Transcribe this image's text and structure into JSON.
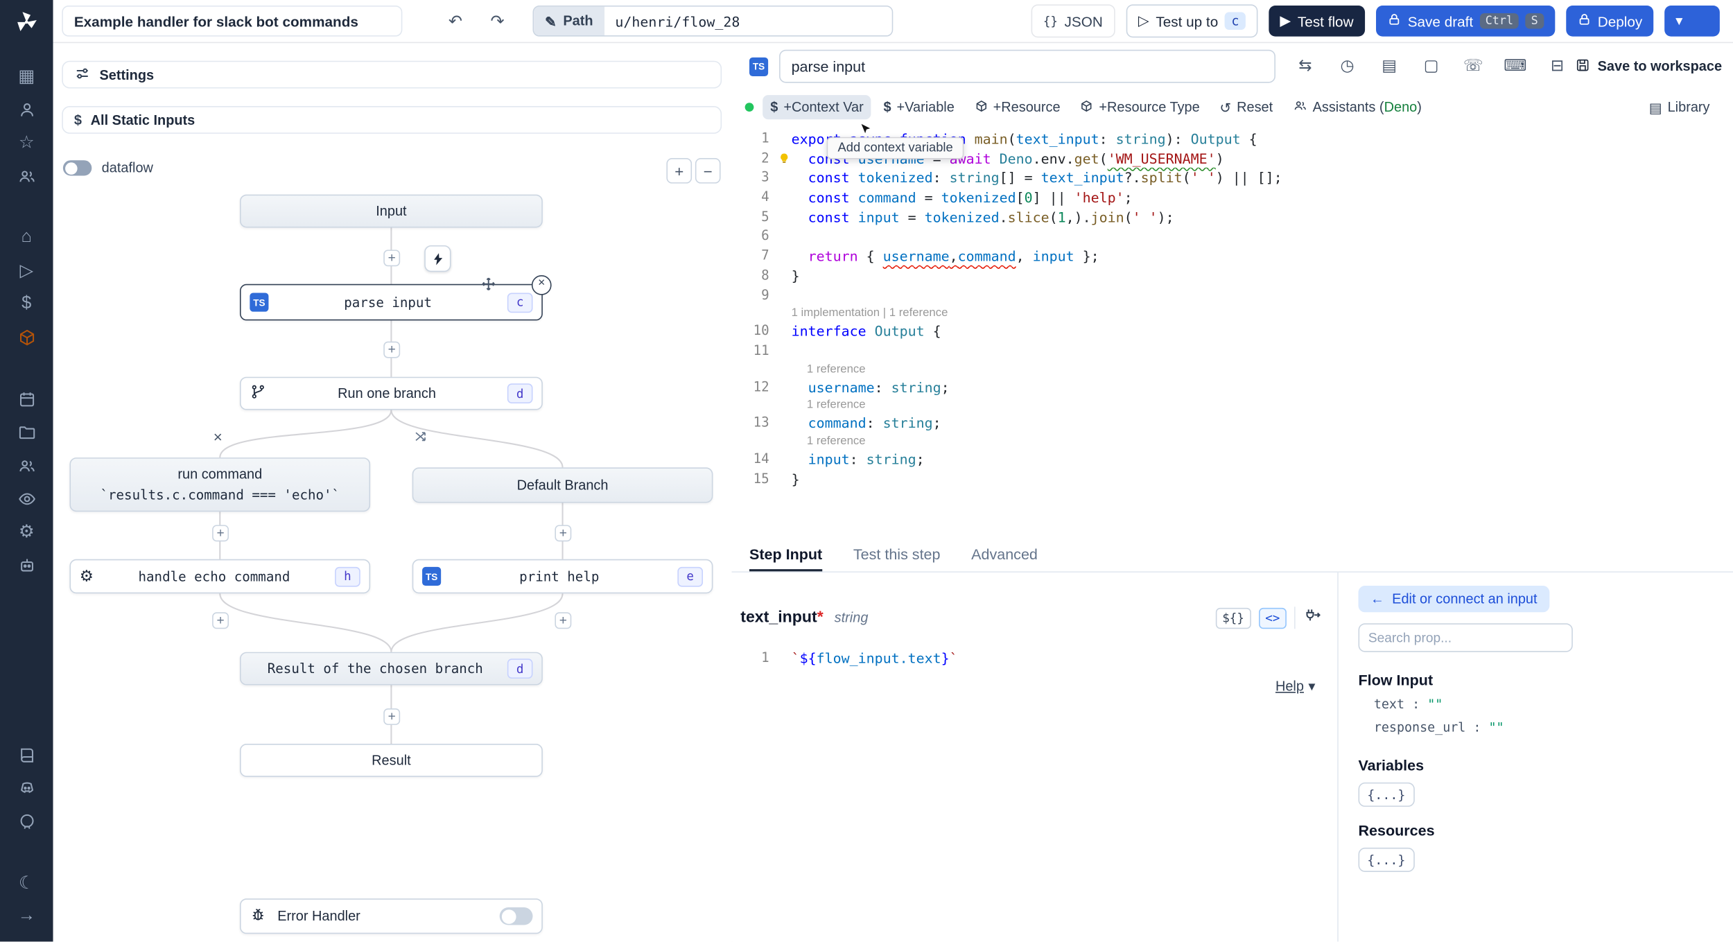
{
  "colors": {
    "accent_blue": "#2d62d9",
    "dark_navy": "#182642",
    "sidebar_bg": "#1e293b",
    "deno_green": "#15803d",
    "lsp_green": "#22c55e",
    "badge_indigo_border": "#c7d2fe"
  },
  "icons": {
    "plus": "+",
    "minus": "−",
    "undo": "↶",
    "redo": "↷",
    "pencil": "✎",
    "chevron_down": "▾",
    "braces": "{}",
    "grid": "▦",
    "home": "⌂",
    "star": "☆",
    "dollar": "$",
    "gear": "⚙",
    "moon": "☾",
    "arrow_right": "→",
    "play_outline": "▷",
    "play_solid": "▶",
    "sync": "⇆",
    "gauge": "◷",
    "docs": "▤",
    "window": "▢",
    "phone": "☏",
    "keyboard": "⌨",
    "tape": "⊟",
    "reset": "↺",
    "close": "×",
    "arrow_left": "←"
  },
  "topbar": {
    "title": "Example handler for slack bot commands",
    "path_label": "Path",
    "path_value": "u/henri/flow_28",
    "json_label": "JSON",
    "test_up_to_label": "Test up to",
    "test_up_to_badge": "c",
    "test_flow_label": "Test flow",
    "save_draft_label": "Save draft",
    "kbd_ctrl": "Ctrl",
    "kbd_s": "S",
    "deploy_label": "Deploy"
  },
  "flow": {
    "settings_label": "Settings",
    "static_inputs_label": "All Static Inputs",
    "dataflow_label": "dataflow",
    "nodes": {
      "input": "Input",
      "parse_input": {
        "label": "parse input",
        "badge": "c"
      },
      "run_one_branch": {
        "label": "Run one branch",
        "badge": "d"
      },
      "branch_command": {
        "label": "run command",
        "condition": "`results.c.command === 'echo'`"
      },
      "default_branch": "Default Branch",
      "handle_echo": {
        "label": "handle echo command",
        "badge": "h"
      },
      "print_help": {
        "label": "print help",
        "badge": "e"
      },
      "result_chosen": {
        "label": "Result of the chosen branch",
        "badge": "d"
      },
      "result": "Result",
      "error_handler": "Error Handler"
    }
  },
  "editor": {
    "lang_badge": "TS",
    "step_name": "parse input",
    "save_to_workspace": "Save to workspace",
    "buttons": {
      "context_var": "+Context Var",
      "variable": "+Variable",
      "resource": "+Resource",
      "resource_type": "+Resource Type",
      "reset": "Reset",
      "assistants_prefix": "Assistants (",
      "assistants_lang": "Deno",
      "assistants_suffix": ")",
      "library": "Library"
    },
    "tooltip": "Add context variable",
    "code": {
      "lines": [
        {
          "n": 1,
          "t": [
            [
              "export",
              "k"
            ],
            [
              " ",
              "p"
            ],
            [
              "async",
              "k"
            ],
            [
              " ",
              "p"
            ],
            [
              "function",
              "k"
            ],
            [
              " ",
              "p"
            ],
            [
              "main",
              "f"
            ],
            [
              "(",
              "p"
            ],
            [
              "text_input",
              "v"
            ],
            [
              ": ",
              "p"
            ],
            [
              "string",
              "t"
            ],
            [
              "): ",
              "p"
            ],
            [
              "Output",
              "t"
            ],
            [
              " {",
              "p"
            ]
          ]
        },
        {
          "n": 2,
          "bulb": true,
          "t": [
            [
              "  ",
              "p"
            ],
            [
              "const",
              "k"
            ],
            [
              " ",
              "p"
            ],
            [
              "username",
              "v"
            ],
            [
              " = ",
              "p"
            ],
            [
              "await",
              "c"
            ],
            [
              " ",
              "p"
            ],
            [
              "Deno",
              "t"
            ],
            [
              ".env.",
              "p"
            ],
            [
              "get",
              "f"
            ],
            [
              "(",
              "p"
            ],
            [
              "'WM_USERNAME'",
              "s g"
            ],
            [
              ")",
              "p"
            ]
          ]
        },
        {
          "n": 3,
          "t": [
            [
              "  ",
              "p"
            ],
            [
              "const",
              "k"
            ],
            [
              " ",
              "p"
            ],
            [
              "tokenized",
              "v"
            ],
            [
              ": ",
              "p"
            ],
            [
              "string",
              "t"
            ],
            [
              "[] = ",
              "p"
            ],
            [
              "text_input",
              "v"
            ],
            [
              "?.",
              "p"
            ],
            [
              "split",
              "f"
            ],
            [
              "(",
              "p"
            ],
            [
              "' '",
              "s"
            ],
            [
              ") || [];",
              "p"
            ]
          ]
        },
        {
          "n": 4,
          "t": [
            [
              "  ",
              "p"
            ],
            [
              "const",
              "k"
            ],
            [
              " ",
              "p"
            ],
            [
              "command",
              "v"
            ],
            [
              " = ",
              "p"
            ],
            [
              "tokenized",
              "v"
            ],
            [
              "[",
              "p"
            ],
            [
              "0",
              "n"
            ],
            [
              "] || ",
              "p"
            ],
            [
              "'help'",
              "s"
            ],
            [
              ";",
              "p"
            ]
          ]
        },
        {
          "n": 5,
          "t": [
            [
              "  ",
              "p"
            ],
            [
              "const",
              "k"
            ],
            [
              " ",
              "p"
            ],
            [
              "input",
              "v"
            ],
            [
              " = ",
              "p"
            ],
            [
              "tokenized",
              "v"
            ],
            [
              ".",
              "p"
            ],
            [
              "slice",
              "f"
            ],
            [
              "(",
              "p"
            ],
            [
              "1",
              "n"
            ],
            [
              ",).",
              "p"
            ],
            [
              "join",
              "f"
            ],
            [
              "(",
              "p"
            ],
            [
              "' '",
              "s"
            ],
            [
              ");",
              "p"
            ]
          ]
        },
        {
          "n": 6,
          "t": []
        },
        {
          "n": 7,
          "t": [
            [
              "  ",
              "p"
            ],
            [
              "return",
              "c"
            ],
            [
              " { ",
              "p"
            ],
            [
              "username",
              "v r"
            ],
            [
              ",",
              "p r"
            ],
            [
              "command",
              "v r"
            ],
            [
              ", ",
              "p"
            ],
            [
              "input",
              "v"
            ],
            [
              " };",
              "p"
            ]
          ]
        },
        {
          "n": 8,
          "t": [
            [
              "}",
              "p"
            ]
          ]
        },
        {
          "n": 9,
          "t": []
        },
        {
          "lens": "1 implementation | 1 reference"
        },
        {
          "n": 10,
          "t": [
            [
              "interface",
              "k"
            ],
            [
              " ",
              "p"
            ],
            [
              "Output",
              "t"
            ],
            [
              " {",
              "p"
            ]
          ]
        },
        {
          "n": 11,
          "t": []
        },
        {
          "lens": "1 reference",
          "ind": true
        },
        {
          "n": 12,
          "t": [
            [
              "  ",
              "p"
            ],
            [
              "username",
              "v"
            ],
            [
              ": ",
              "p"
            ],
            [
              "string",
              "t"
            ],
            [
              ";",
              "p"
            ]
          ]
        },
        {
          "lens": "1 reference",
          "ind": true
        },
        {
          "n": 13,
          "t": [
            [
              "  ",
              "p"
            ],
            [
              "command",
              "v"
            ],
            [
              ": ",
              "p"
            ],
            [
              "string",
              "t"
            ],
            [
              ";",
              "p"
            ]
          ]
        },
        {
          "lens": "1 reference",
          "ind": true
        },
        {
          "n": 14,
          "t": [
            [
              "  ",
              "p"
            ],
            [
              "input",
              "v"
            ],
            [
              ": ",
              "p"
            ],
            [
              "string",
              "t"
            ],
            [
              ";",
              "p"
            ]
          ]
        },
        {
          "n": 15,
          "t": [
            [
              "}",
              "p"
            ]
          ]
        }
      ]
    }
  },
  "tabs": {
    "items": [
      {
        "label": "Step Input"
      },
      {
        "label": "Test this step"
      },
      {
        "label": "Advanced"
      }
    ]
  },
  "step_input": {
    "field_name": "text_input",
    "required_mark": "*",
    "field_type": "string",
    "toggle_templatable": "${}",
    "toggle_code": "<>",
    "help_label": "Help",
    "code": {
      "lines": [
        {
          "n": 1,
          "t": [
            [
              "`",
              "s"
            ],
            [
              "${",
              "k"
            ],
            [
              "flow_input.text",
              "v"
            ],
            [
              "}",
              "k"
            ],
            [
              "`",
              "s"
            ]
          ]
        }
      ]
    }
  },
  "props": {
    "edit_connect_label": "Edit or connect an input",
    "search_placeholder": "Search prop...",
    "flow_input_title": "Flow Input",
    "rows": [
      {
        "key": "text",
        "sep": ":",
        "value": "\"\""
      },
      {
        "key": "response_url",
        "sep": ":",
        "value": "\"\""
      }
    ],
    "variables_title": "Variables",
    "variables_button": "{...}",
    "resources_title": "Resources",
    "resources_button": "{...}"
  }
}
